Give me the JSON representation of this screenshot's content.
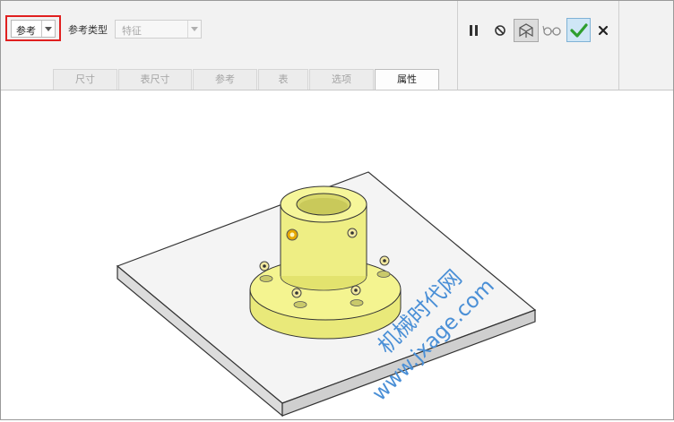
{
  "dashboard": {
    "ref_mode_value": "参考",
    "ref_type_label": "参考类型",
    "ref_type_value": "特征",
    "tabs": [
      {
        "label": "尺寸",
        "active": false
      },
      {
        "label": "表尺寸",
        "active": false
      },
      {
        "label": "参考",
        "active": false
      },
      {
        "label": "表",
        "active": false
      },
      {
        "label": "选项",
        "active": false
      },
      {
        "label": "属性",
        "active": true
      }
    ],
    "tools": {
      "pause": "pause-icon",
      "no_preview": "no-preview-icon",
      "geometry_preview": "geometry-preview-icon",
      "verify": "glasses-icon",
      "ok": "checkmark-icon",
      "cancel": "close-icon"
    }
  },
  "watermark": {
    "line1": "机械时代网",
    "line2": "www.jxage.com"
  },
  "colors": {
    "highlight": "#e02020",
    "part": "#f2f28a",
    "plate": "#f4f4f4",
    "datum_point": "#e6a800",
    "watermark": "#4a8fd6",
    "ok_green": "#2e9e2e"
  }
}
